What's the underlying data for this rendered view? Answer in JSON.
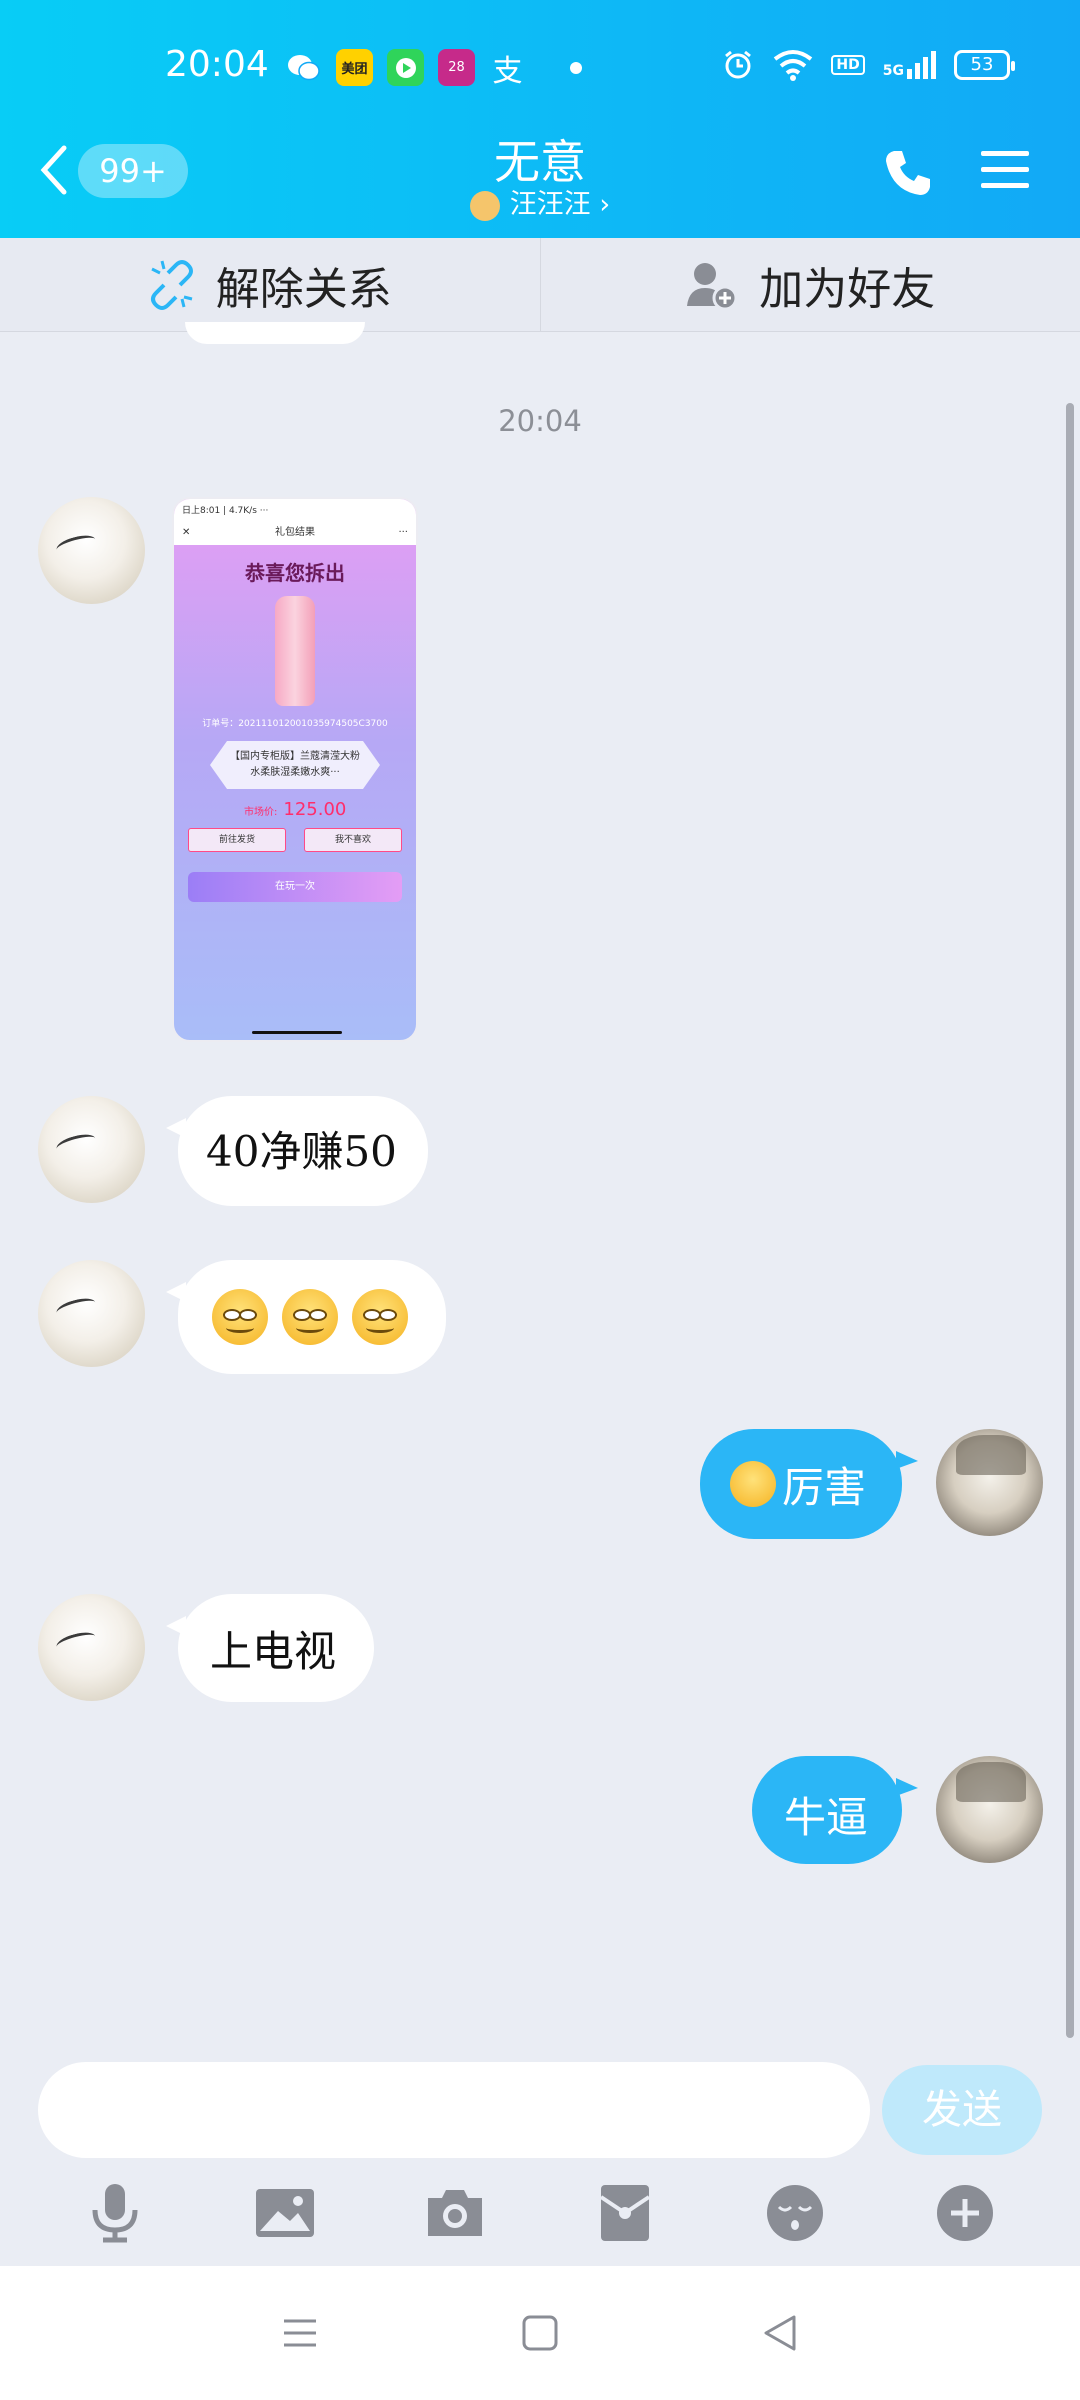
{
  "status_bar": {
    "time": "20:04",
    "apps": [
      {
        "name": "wechat-icon",
        "label": "",
        "color": "#ffffff"
      },
      {
        "name": "meituan-icon",
        "label": "美团",
        "color": "#ffd100"
      },
      {
        "name": "video-app-icon",
        "label": "",
        "color": "#2fd45a"
      },
      {
        "name": "calendar-icon",
        "label": "28",
        "color": "#c62a8a"
      },
      {
        "name": "alipay-icon",
        "label": "支",
        "color": "transparent"
      }
    ],
    "network": "5G",
    "hd": "HD",
    "battery": "53"
  },
  "header": {
    "unread_badge": "99+",
    "title": "无意",
    "subtitle": "汪汪汪 ›"
  },
  "actions": {
    "unbind_label": "解除关系",
    "add_friend_label": "加为好友"
  },
  "chat": {
    "timestamp": "20:04",
    "shared_image": {
      "status": "日上8:01 | 4.7K/s ···",
      "header": "礼包结果",
      "title": "恭喜您拆出",
      "order_no": "订单号：202111012001035974505C3700",
      "product": "【国内专柜版】兰蔻清滢大粉水柔肤湿柔嫩水爽···",
      "price_label": "市场价:",
      "price_value": "125.00",
      "btn_ship": "前往发货",
      "btn_dislike": "我不喜欢",
      "btn_again": "在玩一次"
    },
    "messages": [
      {
        "side": "left",
        "text": "40净赚50"
      },
      {
        "side": "left",
        "text": "",
        "emoji_count": 3
      },
      {
        "side": "right",
        "text": "厉害"
      },
      {
        "side": "left",
        "text": "上电视"
      },
      {
        "side": "right",
        "text": "牛逼"
      }
    ]
  },
  "composer": {
    "input_value": "",
    "send_label": "发送"
  },
  "toolbar": {
    "tools": [
      "microphone-icon",
      "image-icon",
      "camera-icon",
      "red-packet-icon",
      "sticker-icon",
      "plus-icon"
    ]
  },
  "colors": {
    "header_start": "#08cdf6",
    "header_end": "#12a9f6",
    "bubble_out": "#2bb6f6",
    "bubble_in": "#ffffff",
    "background": "#eaedf4",
    "send_disabled": "#bfe9fb"
  }
}
